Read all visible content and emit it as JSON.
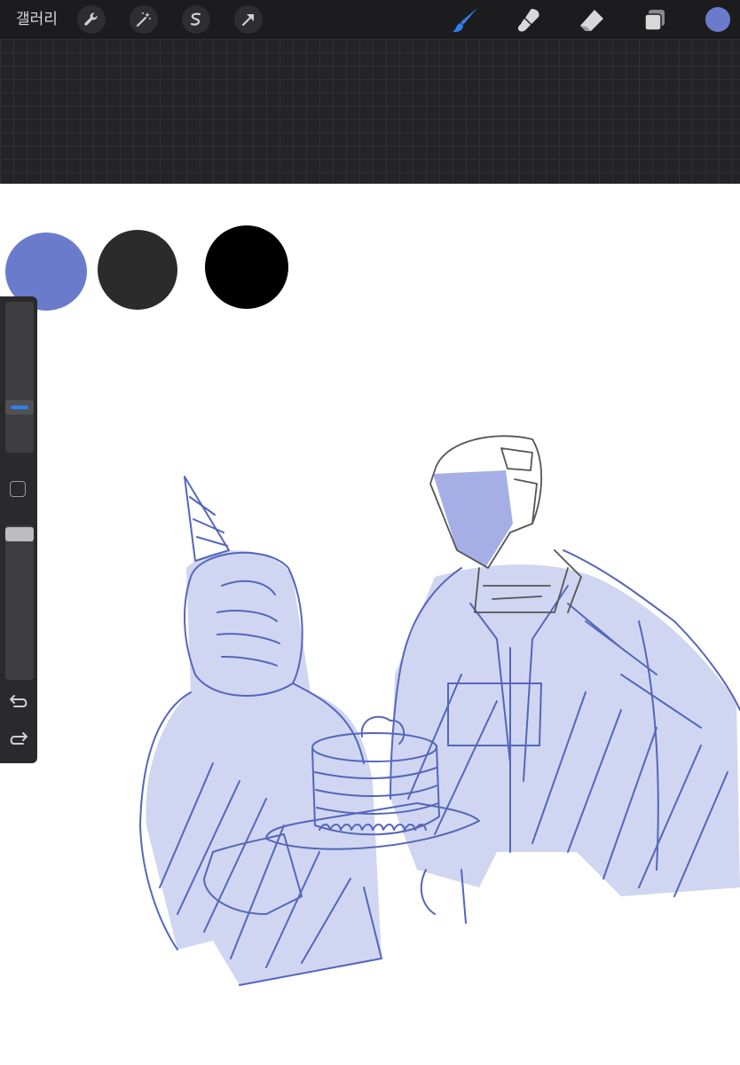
{
  "topbar": {
    "gallery_label": "갤러리",
    "left_tools": [
      "wrench-icon",
      "magic-wand-icon",
      "selection-icon",
      "transform-arrow-icon"
    ],
    "right_tools": [
      "brush-icon",
      "smudge-icon",
      "eraser-icon",
      "layers-icon"
    ],
    "current_color": "#6b7bcc",
    "brush_active_color": "#2f80ed"
  },
  "canvas": {
    "swatches": [
      "#6b7bcc",
      "#2b2b2b",
      "#000000"
    ],
    "sketch_stroke": "#5566bb",
    "sketch_fill": "#aab4e6",
    "line_gray": "#555555"
  },
  "sidebar": {
    "brush_size": 0.28,
    "brush_opacity": 1.0,
    "controls": [
      "brush-size-slider",
      "modify-button",
      "opacity-slider",
      "undo-icon",
      "redo-icon"
    ]
  }
}
